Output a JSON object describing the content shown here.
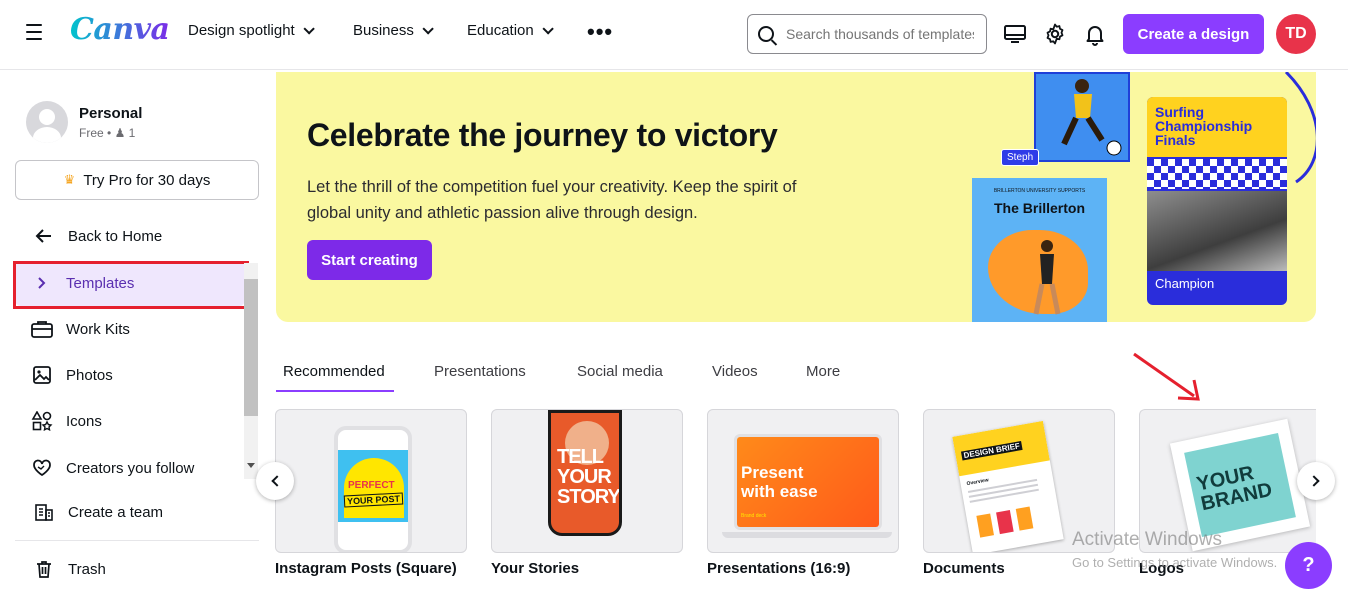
{
  "header": {
    "logo": "Canva",
    "nav": [
      "Design spotlight",
      "Business",
      "Education"
    ],
    "more_icon": "more-horizontal-icon",
    "search_placeholder": "Search thousands of templates",
    "create_label": "Create a design",
    "avatar_initials": "TD",
    "accent_color": "#8b3dff"
  },
  "sidebar": {
    "profile_name": "Personal",
    "profile_plan": "Free",
    "profile_members": "1",
    "try_pro": "Try Pro for 30 days",
    "items": [
      {
        "label": "Back to Home",
        "icon": "arrow-left-icon"
      },
      {
        "label": "Templates",
        "icon": "chevron-right-icon"
      },
      {
        "label": "Work Kits",
        "icon": "briefcase-icon"
      },
      {
        "label": "Photos",
        "icon": "image-icon"
      },
      {
        "label": "Icons",
        "icon": "shapes-icon"
      },
      {
        "label": "Creators you follow",
        "icon": "heart-icon"
      },
      {
        "label": "Create a team",
        "icon": "building-icon"
      },
      {
        "label": "Trash",
        "icon": "trash-icon"
      }
    ]
  },
  "hero": {
    "title": "Celebrate the journey to victory",
    "body": "Let the thrill of the competition fuel your creativity. Keep the spirit of global unity and athletic passion alive through design.",
    "cta": "Start creating",
    "bg_color": "#faf8a0",
    "card_name_tag": "Steph",
    "card_b_small": "BRILLERTON UNIVERSITY SUPPORTS",
    "card_b_title": "The Brillerton",
    "card_c_title": "Surfing Championship Finals",
    "card_c_caption": "Champion"
  },
  "tabs": [
    "Recommended",
    "Presentations",
    "Social media",
    "Videos",
    "More"
  ],
  "tiles": [
    {
      "label": "Instagram Posts (Square)",
      "art_text_1": "PERFECT",
      "art_text_2": "YOUR POST"
    },
    {
      "label": "Your Stories",
      "art_text_1": "TELL YOUR STORY"
    },
    {
      "label": "Presentations (16:9)",
      "art_text_1": "Present with ease",
      "art_text_2": "Brand deck"
    },
    {
      "label": "Documents",
      "art_text_1": "DESIGN BRIEF",
      "art_text_2": "Overview"
    },
    {
      "label": "Logos",
      "art_text_1": "YOUR BRAND"
    }
  ],
  "watermark": {
    "line1": "Activate Windows",
    "line2": "Go to Settings to activate Windows."
  },
  "help_label": "?"
}
